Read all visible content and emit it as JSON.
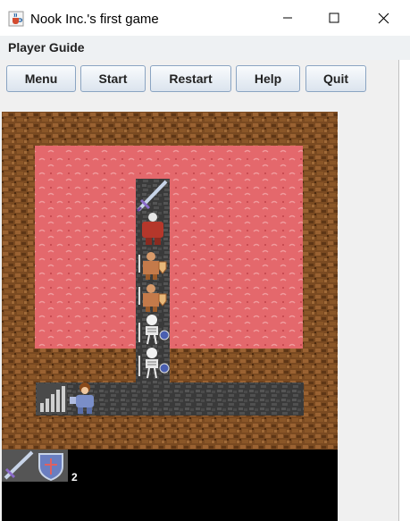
{
  "window": {
    "title": "Nook Inc.'s first game",
    "app_icon": "java-cup-icon",
    "controls": [
      "minimize-icon",
      "maximize-icon",
      "close-icon"
    ]
  },
  "menubar": {
    "items": [
      {
        "label": "Player Guide"
      }
    ]
  },
  "toolbar": {
    "buttons": [
      {
        "label": "Menu"
      },
      {
        "label": "Start"
      },
      {
        "label": "Restart"
      },
      {
        "label": "Help"
      },
      {
        "label": "Quit"
      }
    ]
  },
  "game": {
    "tiles": [
      "wall-tile",
      "lava-tile",
      "stone-floor-tile"
    ],
    "entities": [
      {
        "name": "sword-item-icon"
      },
      {
        "name": "red-armored-warrior-icon"
      },
      {
        "name": "orc-shield-warrior-icon"
      },
      {
        "name": "orc-shield-warrior-icon"
      },
      {
        "name": "skeleton-warrior-icon"
      },
      {
        "name": "skeleton-warrior-icon"
      },
      {
        "name": "staircase-icon"
      },
      {
        "name": "player-knight-icon"
      }
    ]
  },
  "inventory": {
    "items": [
      {
        "name": "sword-icon"
      },
      {
        "name": "shield-icon"
      }
    ],
    "count": "2"
  },
  "colors": {
    "wall": "#7a4a21",
    "lava": "#e4686c",
    "stone": "#3f3f3f",
    "button_border": "#8aa4c2"
  }
}
